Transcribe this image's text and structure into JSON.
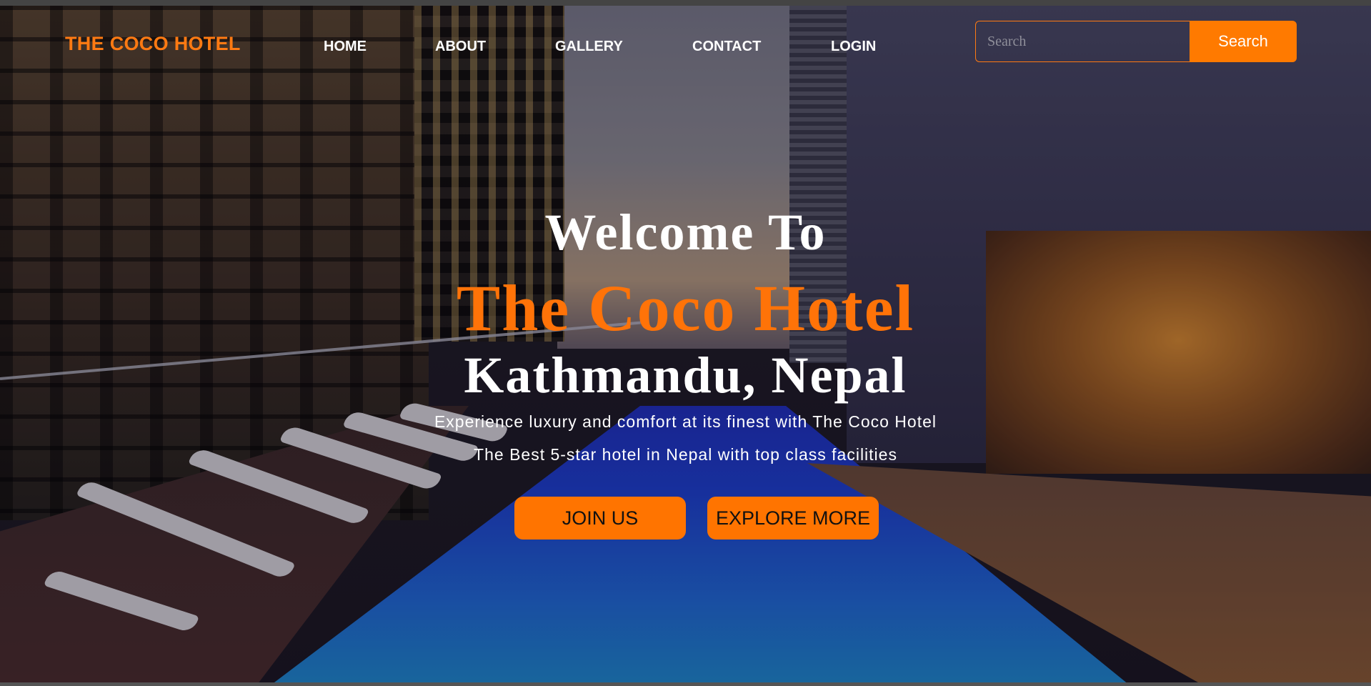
{
  "header": {
    "logo": "THE COCO HOTEL",
    "nav": [
      {
        "label": "HOME"
      },
      {
        "label": "ABOUT"
      },
      {
        "label": "GALLERY"
      },
      {
        "label": "CONTACT"
      },
      {
        "label": "LOGIN"
      }
    ],
    "search": {
      "placeholder": "Search",
      "button_label": "Search"
    }
  },
  "hero": {
    "welcome": "Welcome To",
    "hotel_name": "The Coco Hotel",
    "location": "Kathmandu, Nepal",
    "tagline1": "Experience luxury and comfort at its finest with The Coco Hotel",
    "tagline2": "The Best 5-star hotel in Nepal with top class facilities",
    "buttons": {
      "join": "JOIN US",
      "explore": "EXPLORE MORE"
    }
  },
  "colors": {
    "accent": "#ff7a12",
    "button": "#ff7400",
    "text": "#ffffff"
  }
}
